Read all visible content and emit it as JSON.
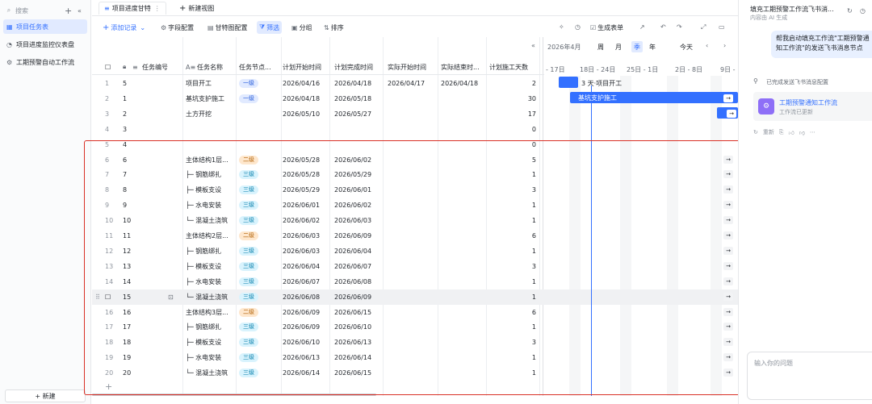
{
  "sidebar": {
    "search_placeholder": "搜索",
    "items": [
      {
        "label": "项目任务表",
        "active": true
      },
      {
        "label": "项目进度监控仪表盘",
        "active": false
      },
      {
        "label": "工期预警自动工作流",
        "active": false
      }
    ],
    "new_label": "+ 新建"
  },
  "tabs": {
    "active_label": "项目进度甘特",
    "new_view_label": "新建视图"
  },
  "toolbar": {
    "add_record": "添加记录",
    "field_config": "字段配置",
    "gantt_config": "甘特图配置",
    "filter": "筛选",
    "group": "分组",
    "sort": "排序",
    "generate_form": "生成表单"
  },
  "columns": {
    "task_no": "任务编号",
    "task_name": "任务名称",
    "task_node": "任务节点...",
    "plan_start": "计划开始时间",
    "plan_end": "计划完成时间",
    "actual_start": "实际开始时间",
    "actual_end": "实际结束时...",
    "plan_days": "计划施工天数"
  },
  "rows": [
    {
      "n": "1",
      "no": "5",
      "name": "项目开工",
      "level": "一级",
      "lv": 1,
      "ps": "2026/04/16",
      "pe": "2026/04/18",
      "as": "2026/04/17",
      "ae": "2026/04/18",
      "days": "2"
    },
    {
      "n": "2",
      "no": "1",
      "name": "基坑支护施工",
      "level": "一级",
      "lv": 1,
      "ps": "2026/04/18",
      "pe": "2026/05/18",
      "as": "",
      "ae": "",
      "days": "30"
    },
    {
      "n": "3",
      "no": "2",
      "name": "土方开挖",
      "level": "",
      "lv": 0,
      "ps": "2026/05/10",
      "pe": "2026/05/27",
      "as": "",
      "ae": "",
      "days": "17"
    },
    {
      "n": "4",
      "no": "3",
      "name": "",
      "level": "",
      "lv": 0,
      "ps": "",
      "pe": "",
      "as": "",
      "ae": "",
      "days": "0"
    },
    {
      "n": "5",
      "no": "4",
      "name": "",
      "level": "",
      "lv": 0,
      "ps": "",
      "pe": "",
      "as": "",
      "ae": "",
      "days": "0"
    },
    {
      "n": "6",
      "no": "6",
      "name": "主体结构1层...",
      "level": "二级",
      "lv": 2,
      "ps": "2026/05/28",
      "pe": "2026/06/02",
      "as": "",
      "ae": "",
      "days": "5"
    },
    {
      "n": "7",
      "no": "7",
      "name": "├─ 钢筋绑扎",
      "level": "三级",
      "lv": 3,
      "ps": "2026/05/28",
      "pe": "2026/05/29",
      "as": "",
      "ae": "",
      "days": "1"
    },
    {
      "n": "8",
      "no": "8",
      "name": "├─ 模板支设",
      "level": "三级",
      "lv": 3,
      "ps": "2026/05/29",
      "pe": "2026/06/01",
      "as": "",
      "ae": "",
      "days": "3"
    },
    {
      "n": "9",
      "no": "9",
      "name": "├─ 水电安装",
      "level": "三级",
      "lv": 3,
      "ps": "2026/06/01",
      "pe": "2026/06/02",
      "as": "",
      "ae": "",
      "days": "1"
    },
    {
      "n": "10",
      "no": "10",
      "name": "└─ 混凝土浇筑",
      "level": "三级",
      "lv": 3,
      "ps": "2026/06/02",
      "pe": "2026/06/03",
      "as": "",
      "ae": "",
      "days": "1"
    },
    {
      "n": "11",
      "no": "11",
      "name": "主体结构2层...",
      "level": "二级",
      "lv": 2,
      "ps": "2026/06/03",
      "pe": "2026/06/09",
      "as": "",
      "ae": "",
      "days": "6"
    },
    {
      "n": "12",
      "no": "12",
      "name": "├─ 钢筋绑扎",
      "level": "三级",
      "lv": 3,
      "ps": "2026/06/03",
      "pe": "2026/06/04",
      "as": "",
      "ae": "",
      "days": "1"
    },
    {
      "n": "13",
      "no": "13",
      "name": "├─ 模板支设",
      "level": "三级",
      "lv": 3,
      "ps": "2026/06/04",
      "pe": "2026/06/07",
      "as": "",
      "ae": "",
      "days": "3"
    },
    {
      "n": "14",
      "no": "14",
      "name": "├─ 水电安装",
      "level": "三级",
      "lv": 3,
      "ps": "2026/06/07",
      "pe": "2026/06/08",
      "as": "",
      "ae": "",
      "days": "1"
    },
    {
      "n": "",
      "no": "15",
      "name": "└─ 混凝土浇筑",
      "level": "三级",
      "lv": 3,
      "ps": "2026/06/08",
      "pe": "2026/06/09",
      "as": "",
      "ae": "",
      "days": "1"
    },
    {
      "n": "16",
      "no": "16",
      "name": "主体结构3层...",
      "level": "二级",
      "lv": 2,
      "ps": "2026/06/09",
      "pe": "2026/06/15",
      "as": "",
      "ae": "",
      "days": "6"
    },
    {
      "n": "17",
      "no": "17",
      "name": "├─ 钢筋绑扎",
      "level": "三级",
      "lv": 3,
      "ps": "2026/06/09",
      "pe": "2026/06/10",
      "as": "",
      "ae": "",
      "days": "1"
    },
    {
      "n": "18",
      "no": "18",
      "name": "├─ 模板支设",
      "level": "三级",
      "lv": 3,
      "ps": "2026/06/10",
      "pe": "2026/06/13",
      "as": "",
      "ae": "",
      "days": "3"
    },
    {
      "n": "19",
      "no": "19",
      "name": "├─ 水电安装",
      "level": "三级",
      "lv": 3,
      "ps": "2026/06/13",
      "pe": "2026/06/14",
      "as": "",
      "ae": "",
      "days": "1"
    },
    {
      "n": "20",
      "no": "20",
      "name": "└─ 混凝土浇筑",
      "level": "三级",
      "lv": 3,
      "ps": "2026/06/14",
      "pe": "2026/06/15",
      "as": "",
      "ae": "",
      "days": "1"
    }
  ],
  "gantt": {
    "month_label": "2026年4月",
    "scale_week": "周",
    "scale_month": "月",
    "scale_quarter": "季",
    "scale_year": "年",
    "today": "今天",
    "date_labels": [
      "- 17日",
      "18日 - 24日",
      "25日 - 1日",
      "2日 - 8日",
      "9日 -"
    ],
    "bar1_label": "3 天·项目开工",
    "bar2_label": "基坑支护施工"
  },
  "assistant": {
    "title": "填充工期预警工作流飞书消...",
    "subtitle": "内容由 AI 生成",
    "message": "帮我启动填充工作流\"工期预警通知工作流\"的发送飞书消息节点",
    "status": "已完成发送飞书消息配置",
    "card_title": "工期预警通知工作流",
    "card_sub": "工作流已更新",
    "retry": "重新",
    "input_placeholder": "输入你的问题"
  },
  "colors": {
    "accent": "#3370ff",
    "frame": "#d93026"
  }
}
